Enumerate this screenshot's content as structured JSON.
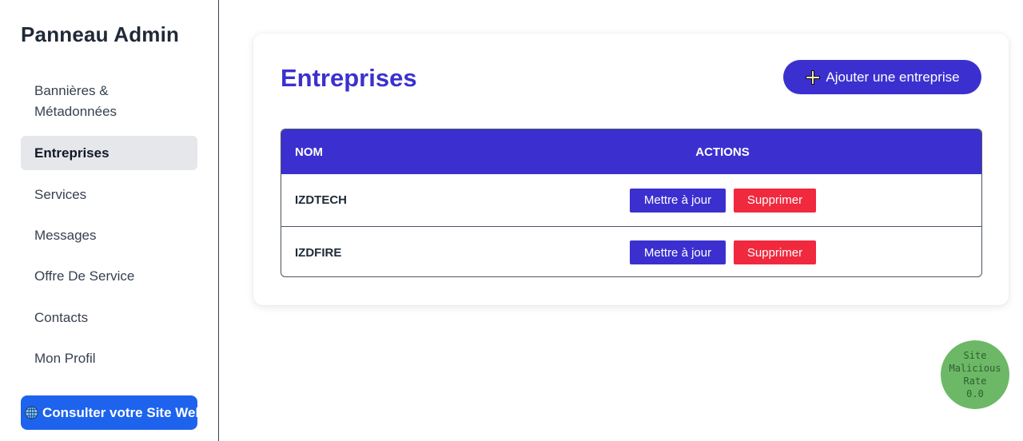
{
  "sidebar": {
    "title": "Panneau Admin",
    "items": [
      {
        "label": "Bannières & Métadonnées"
      },
      {
        "label": "Entreprises"
      },
      {
        "label": "Services"
      },
      {
        "label": "Messages"
      },
      {
        "label": "Offre De Service"
      },
      {
        "label": "Contacts"
      },
      {
        "label": "Mon Profil"
      }
    ],
    "active_item": "Entreprises",
    "site_button_label": "Consulter votre Site Web"
  },
  "main": {
    "title": "Entreprises",
    "add_button_label": "Ajouter une entreprise",
    "table": {
      "columns": [
        "NOM",
        "ACTIONS"
      ],
      "rows": [
        {
          "name": "IZDTECH",
          "update_label": "Mettre à jour",
          "delete_label": "Supprimer"
        },
        {
          "name": "IZDFIRE",
          "update_label": "Mettre à jour",
          "delete_label": "Supprimer"
        }
      ]
    }
  },
  "rate_badge": {
    "line1": "Site",
    "line2": "Malicious",
    "line3": "Rate",
    "value": "0.0"
  },
  "icons": {
    "add": "plus-icon",
    "site": "globe-icon"
  },
  "colors": {
    "accent": "#3b30cf",
    "danger": "#f0293e",
    "site_button": "#1d63ed",
    "active_nav": "#e5e7eb",
    "badge": "#6cb866"
  }
}
